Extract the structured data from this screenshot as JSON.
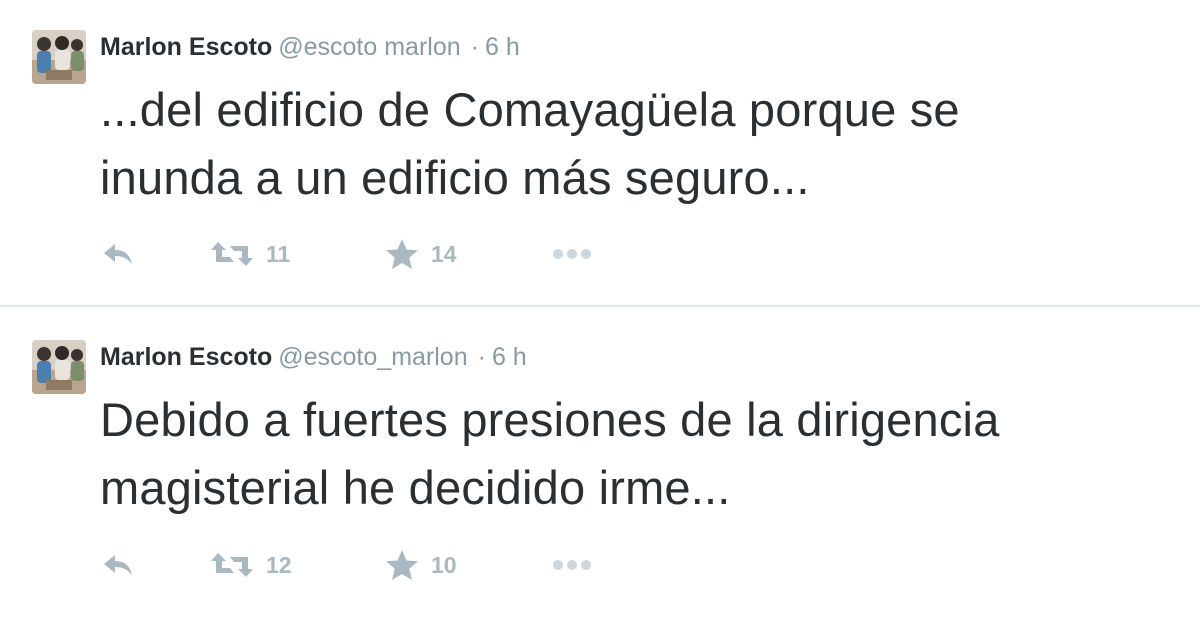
{
  "tweets": [
    {
      "user_name": "Marlon Escoto",
      "handle": "@escoto  marlon",
      "dot": "·",
      "time": "6 h",
      "text": "...del edificio de Comayagüela porque se\ninunda a un edificio más seguro...",
      "retweets": "11",
      "favorites": "14"
    },
    {
      "user_name": "Marlon Escoto",
      "handle": "@escoto_marlon",
      "dot": "·",
      "time": "6 h",
      "text": "Debido a fuertes presiones de la dirigencia\nmagisterial he decidido irme...",
      "retweets": "12",
      "favorites": "10"
    }
  ],
  "icons": {
    "reply": "reply-icon",
    "retweet": "retweet-icon",
    "favorite": "star-icon",
    "more": "more-icon",
    "avatar": "avatar-photo"
  },
  "colors": {
    "text": "#292f33",
    "meta": "#8899a6",
    "action": "#aab8c2",
    "divider": "#e1e8ed"
  }
}
